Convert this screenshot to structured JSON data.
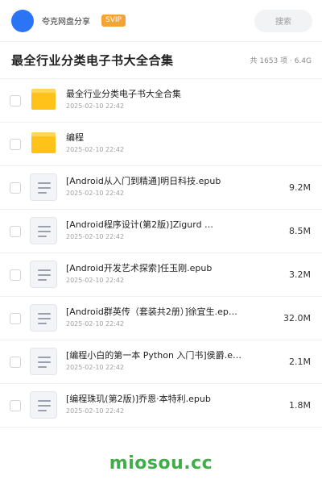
{
  "topbar": {
    "owner": "夸克网盘分享",
    "badge": "SVIP",
    "search_label": "搜索"
  },
  "header": {
    "title": "最全行业分类电子书大全合集",
    "summary": "共 1653 项 · 6.4G"
  },
  "items": [
    {
      "type": "folder",
      "name": "最全行业分类电子书大全合集",
      "date": "2025-02-10 22:42",
      "size": ""
    },
    {
      "type": "folder",
      "name": "编程",
      "date": "2025-02-10 22:42",
      "size": ""
    },
    {
      "type": "file",
      "name": "[Android从入门到精通]明日科技.epub",
      "date": "2025-02-10 22:42",
      "size": "9.2M"
    },
    {
      "type": "file",
      "name": "[Android程序设计(第2版)]Zigurd …",
      "date": "2025-02-10 22:42",
      "size": "8.5M"
    },
    {
      "type": "file",
      "name": "[Android开发艺术探索]任玉刚.epub",
      "date": "2025-02-10 22:42",
      "size": "3.2M"
    },
    {
      "type": "file",
      "name": "[Android群英传（套装共2册）]徐宜生.ep…",
      "date": "2025-02-10 22:42",
      "size": "32.0M"
    },
    {
      "type": "file",
      "name": "[编程小白的第一本 Python 入门书]侯爵.e…",
      "date": "2025-02-10 22:42",
      "size": "2.1M"
    },
    {
      "type": "file",
      "name": "[编程珠玑(第2版)]乔恩·本特利.epub",
      "date": "2025-02-10 22:42",
      "size": "1.8M"
    }
  ],
  "watermark": "miosou.cc",
  "colors": {
    "avatar": "#2b74f6",
    "badge": "#f3a436",
    "folder": "#ffc21a",
    "watermark": "#3fae49"
  }
}
